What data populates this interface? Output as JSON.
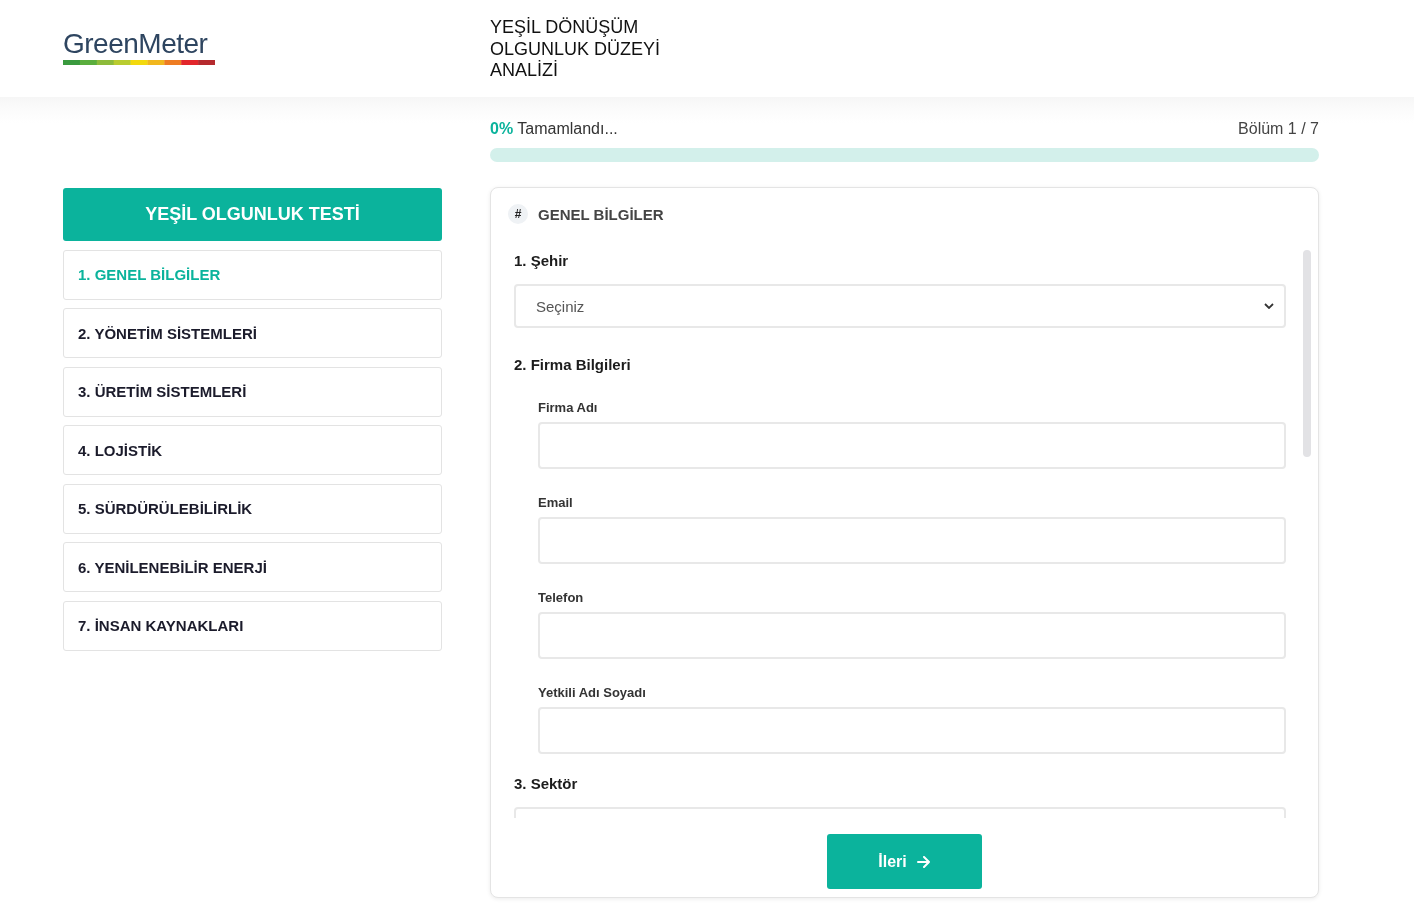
{
  "header": {
    "logo": "GreenMeter",
    "title": "YEŞİL DÖNÜŞÜM OLGUNLUK DÜZEYİ ANALİZİ"
  },
  "progress": {
    "percent": "0%",
    "label": "Tamamlandı...",
    "section": "Bölüm 1 / 7"
  },
  "sidebar": {
    "title": "YEŞİL OLGUNLUK TESTİ",
    "items": [
      {
        "label": "1. GENEL BİLGİLER",
        "selected": true
      },
      {
        "label": "2. YÖNETİM SİSTEMLERİ",
        "selected": false
      },
      {
        "label": "3. ÜRETİM SİSTEMLERİ",
        "selected": false
      },
      {
        "label": "4. LOJİSTİK",
        "selected": false
      },
      {
        "label": "5. SÜRDÜRÜLEBİLİRLİK",
        "selected": false
      },
      {
        "label": "6. YENİLENEBİLİR ENERJİ",
        "selected": false
      },
      {
        "label": "7. İNSAN KAYNAKLARI",
        "selected": false
      }
    ]
  },
  "form": {
    "section_icon": "#",
    "section_title": "GENEL BİLGİLER",
    "questions": [
      {
        "kind": "select",
        "label": "1. Şehir",
        "value": "Seçiniz"
      },
      {
        "kind": "group",
        "label": "2. Firma Bilgileri",
        "fields": [
          {
            "label": "Firma Adı"
          },
          {
            "label": "Email"
          },
          {
            "label": "Telefon"
          },
          {
            "label": "Yetkili Adı Soyadı"
          }
        ]
      },
      {
        "kind": "select",
        "label": "3. Sektör"
      }
    ],
    "next_button": "İleri"
  }
}
